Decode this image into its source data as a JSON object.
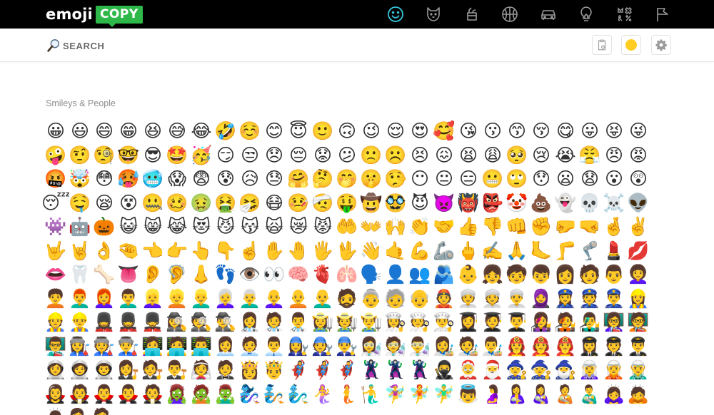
{
  "brand": {
    "word": "emoji",
    "box": "COPY",
    "accent": "#2fb84a"
  },
  "categories": [
    {
      "name": "smileys-people",
      "active": true
    },
    {
      "name": "animals-nature",
      "active": false
    },
    {
      "name": "food-drink",
      "active": false
    },
    {
      "name": "activity",
      "active": false
    },
    {
      "name": "travel-places",
      "active": false
    },
    {
      "name": "objects",
      "active": false
    },
    {
      "name": "symbols",
      "active": false
    },
    {
      "name": "flags",
      "active": false
    }
  ],
  "search": {
    "placeholder": "SEARCH",
    "value": ""
  },
  "toolbar": {
    "clipboard_icon": "clipboard-icon",
    "skin_tone_color": "#ffcc22",
    "settings_icon": "gear-icon"
  },
  "colors": {
    "active_category": "#35c4d8",
    "inactive_category": "#9a9a9a"
  },
  "section_title": "Smileys & People",
  "emojis": [
    "😀",
    "😃",
    "😄",
    "😁",
    "😆",
    "😅",
    "😂",
    "🤣",
    "☺️",
    "😊",
    "😇",
    "🙂",
    "🙃",
    "😉",
    "😌",
    "😍",
    "🥰",
    "😘",
    "😗",
    "😙",
    "😚",
    "😋",
    "😛",
    "😝",
    "😜",
    "🤪",
    "🤨",
    "🧐",
    "🤓",
    "😎",
    "🤩",
    "🥳",
    "😏",
    "😒",
    "😞",
    "😔",
    "😟",
    "😕",
    "🙁",
    "☹️",
    "😣",
    "😖",
    "😫",
    "😩",
    "🥺",
    "😢",
    "😭",
    "😤",
    "😠",
    "😡",
    "🤬",
    "🤯",
    "😳",
    "🥵",
    "🥶",
    "😱",
    "😨",
    "😰",
    "😥",
    "😓",
    "🤗",
    "🤔",
    "🤭",
    "🤫",
    "🤥",
    "😶",
    "😐",
    "😑",
    "😬",
    "🙄",
    "😯",
    "😦",
    "😧",
    "😮",
    "😲",
    "😴",
    "🤤",
    "😪",
    "😵",
    "🤐",
    "🥴",
    "🤢",
    "🤮",
    "🤧",
    "😷",
    "🤒",
    "🤕",
    "🤑",
    "🤠",
    "🥸",
    "😈",
    "👿",
    "👹",
    "👺",
    "🤡",
    "💩",
    "👻",
    "💀",
    "☠️",
    "👽",
    "👾",
    "🤖",
    "🎃",
    "😺",
    "😸",
    "😹",
    "😻",
    "😼",
    "😽",
    "🙀",
    "😿",
    "😾",
    "🤲",
    "👐",
    "🙌",
    "👏",
    "🤝",
    "👍",
    "👎",
    "👊",
    "✊",
    "🤛",
    "🤜",
    "🤞",
    "✌️",
    "🤟",
    "🤘",
    "👌",
    "🤏",
    "👈",
    "👉",
    "👆",
    "👇",
    "☝️",
    "✋",
    "🤚",
    "🖐️",
    "🖖",
    "👋",
    "🤙",
    "💪",
    "🦾",
    "🖕",
    "✍️",
    "🙏",
    "🦶",
    "🦵",
    "🦿",
    "💄",
    "💋",
    "👄",
    "🦷",
    "🦴",
    "👅",
    "👂",
    "🦻",
    "👃",
    "👣",
    "👁️",
    "👀",
    "🧠",
    "🫀",
    "🫁",
    "🗣️",
    "👤",
    "👥",
    "🫂",
    "👶",
    "👧",
    "🧒",
    "👦",
    "👩",
    "🧑",
    "👨",
    "👩‍🦱",
    "🧑‍🦱",
    "👨‍🦰",
    "👩‍🦰",
    "👨‍🦱",
    "👱‍♀️",
    "👱",
    "👱‍♂️",
    "👩‍🦳",
    "👨‍🦳",
    "👩‍🦲",
    "🧑‍🦲",
    "👨‍🦲",
    "🧔",
    "👵",
    "🧓",
    "👴",
    "👲",
    "👳‍♀️",
    "👳",
    "👳‍♂️",
    "🧕",
    "👮‍♀️",
    "👮",
    "👮‍♂️",
    "👷‍♀️",
    "👷",
    "👷‍♂️",
    "💂‍♀️",
    "💂",
    "💂‍♂️",
    "🕵️‍♀️",
    "🕵️",
    "🕵️‍♂️",
    "👩‍⚕️",
    "🧑‍⚕️",
    "👨‍⚕️",
    "👩‍🌾",
    "🧑‍🌾",
    "👨‍🌾",
    "👩‍🍳",
    "🧑‍🍳",
    "👨‍🍳",
    "👩‍🎓",
    "🧑‍🎓",
    "👨‍🎓",
    "👩‍🎤",
    "🧑‍🎤",
    "👨‍🎤",
    "👩‍🏫",
    "🧑‍🏫",
    "👨‍🏫",
    "👩‍🏭",
    "🧑‍🏭",
    "👨‍🏭",
    "👩‍💻",
    "🧑‍💻",
    "👨‍💻",
    "👩‍💼",
    "🧑‍💼",
    "👨‍💼",
    "👩‍🔧",
    "🧑‍🔧",
    "👨‍🔧",
    "👩‍🔬",
    "🧑‍🔬",
    "👨‍🔬",
    "👩‍🎨",
    "🧑‍🎨",
    "👨‍🎨",
    "👩‍🚒",
    "🧑‍🚒",
    "👨‍🚒",
    "👩‍✈️",
    "🧑‍✈️",
    "👨‍✈️",
    "👩‍🚀",
    "🧑‍🚀",
    "👨‍🚀",
    "👩‍⚖️",
    "🧑‍⚖️",
    "👨‍⚖️",
    "👰",
    "🤵",
    "👸",
    "🤴",
    "🦸‍♀️",
    "🦸",
    "🦸‍♂️",
    "🦹‍♀️",
    "🦹",
    "🦹‍♂️",
    "🥷",
    "🤶",
    "🎅",
    "🧙‍♀️",
    "🧙",
    "🧙‍♂️",
    "🧝‍♀️",
    "🧝",
    "🧝‍♂️",
    "🧛‍♀️",
    "🧛",
    "🧛‍♂️",
    "🧛‍♂️",
    "🧛",
    "🧟‍♀️",
    "🧟",
    "🧟‍♂️",
    "🧞‍♀️",
    "🧞",
    "🧞‍♂️",
    "🧜‍♀️",
    "🧜",
    "🧜‍♂️",
    "🧚‍♀️",
    "🧚",
    "🧚‍♂️",
    "👼",
    "🤰",
    "🤱",
    "👩‍🍼",
    "🧑‍🍼",
    "👨‍🍼",
    "🙇‍♀️",
    "🙇",
    "🙇‍♂️",
    "💁‍♀️",
    "💁"
  ]
}
